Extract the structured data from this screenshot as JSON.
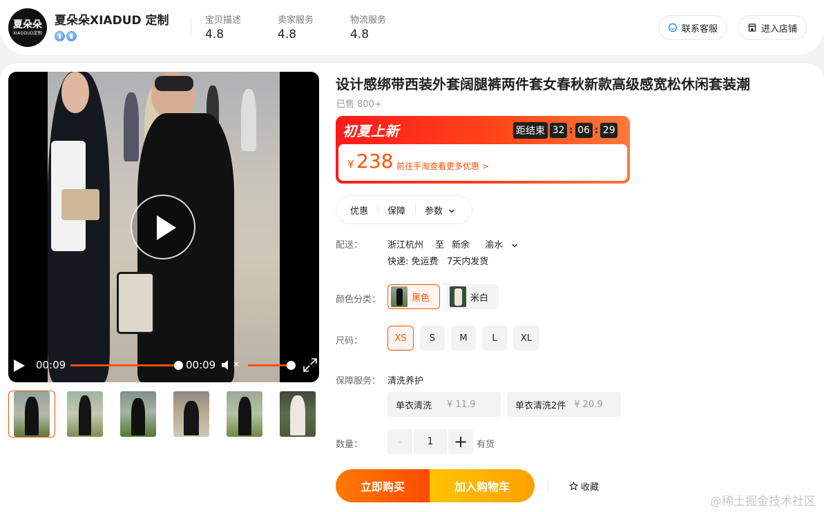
{
  "shop": {
    "logo_line1": "夏朵朵",
    "logo_line2": "XIAODUD定制",
    "name": "夏朵朵XIADUD 定制",
    "scores": [
      {
        "label": "宝贝描述",
        "value": "4.8"
      },
      {
        "label": "卖家服务",
        "value": "4.8"
      },
      {
        "label": "物流服务",
        "value": "4.8"
      }
    ],
    "contact_label": "联系客服",
    "enter_shop_label": "进入店铺"
  },
  "video": {
    "current_time": "00:09",
    "duration": "00:09",
    "progress_percent": 100,
    "volume_percent": 100
  },
  "thumbnails": [
    "thumb-1",
    "thumb-2",
    "thumb-3",
    "thumb-4",
    "thumb-5",
    "thumb-6"
  ],
  "product": {
    "title": "设计感绑带西装外套阔腿裤两件套女春秋新款高级感宽松休闲套装潮",
    "sold": "已售 800+",
    "promo_title": "初夏上新",
    "countdown_label": "距结束",
    "countdown": [
      "32",
      "06",
      "29"
    ],
    "currency": "¥",
    "price": "238",
    "more_offers": "前往手淘查看更多优惠 >"
  },
  "tabs": {
    "discount": "优惠",
    "guarantee": "保障",
    "params": "参数"
  },
  "delivery": {
    "label": "配送：",
    "from": "浙江杭州",
    "to_word": "至",
    "city": "新余",
    "district": "渝水",
    "express": "快递: 免运费",
    "ship_time": "7天内发货"
  },
  "color": {
    "label": "颜色分类：",
    "options": [
      "黑色",
      "米白"
    ],
    "selected": "黑色"
  },
  "size": {
    "label": "尺码：",
    "options": [
      "XS",
      "S",
      "M",
      "L",
      "XL"
    ],
    "selected": "XS"
  },
  "service": {
    "label": "保障服务：",
    "title": "清洗养护",
    "options": [
      {
        "name": "单衣清洗",
        "price": "¥ 11.9"
      },
      {
        "name": "单衣清洗2件",
        "price": "¥ 20.9"
      }
    ]
  },
  "quantity": {
    "label": "数量：",
    "minus": "-",
    "value": "1",
    "plus": "+",
    "stock": "有货"
  },
  "actions": {
    "buy_now": "立即购买",
    "add_cart": "加入购物车",
    "favorite": "收藏"
  },
  "watermark": "@稀土掘金技术社区",
  "colors": {
    "accent": "#ff5000",
    "promo_red": "#ff1a1a",
    "cart_yellow": "#ffc400"
  }
}
